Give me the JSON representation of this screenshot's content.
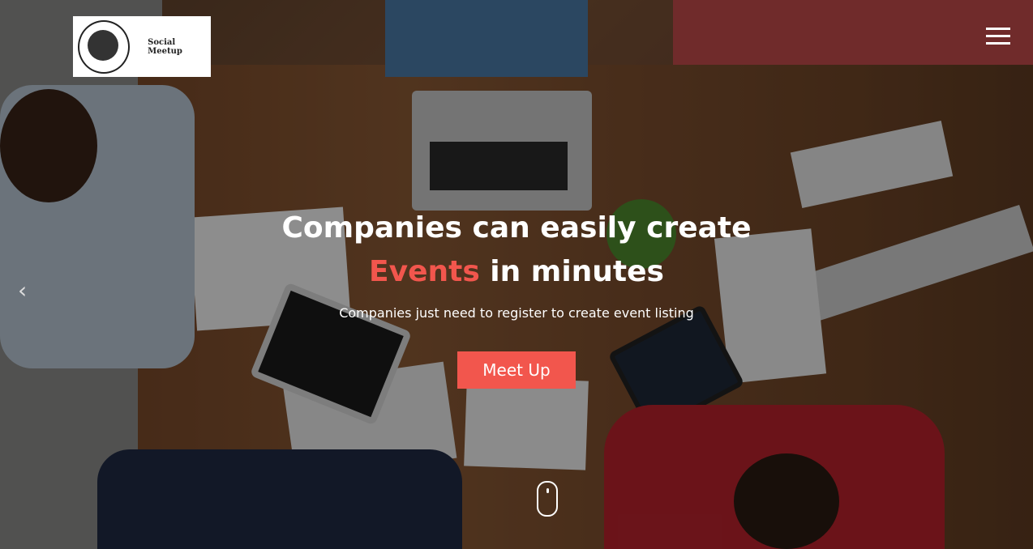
{
  "brand": {
    "logo_text": "Social Meetup",
    "icon": "globe-logo-icon"
  },
  "nav": {
    "menu_icon": "hamburger-menu-icon"
  },
  "hero": {
    "headline_pre": "Companies can easily create ",
    "headline_accent": "Events",
    "headline_post": " in minutes",
    "subtitle": "Companies just need to register to create event listing",
    "cta_label": "Meet Up"
  },
  "carousel": {
    "prev_icon": "chevron-left-icon"
  },
  "scroll": {
    "icon": "mouse-scroll-icon"
  },
  "colors": {
    "accent": "#f2564d"
  }
}
